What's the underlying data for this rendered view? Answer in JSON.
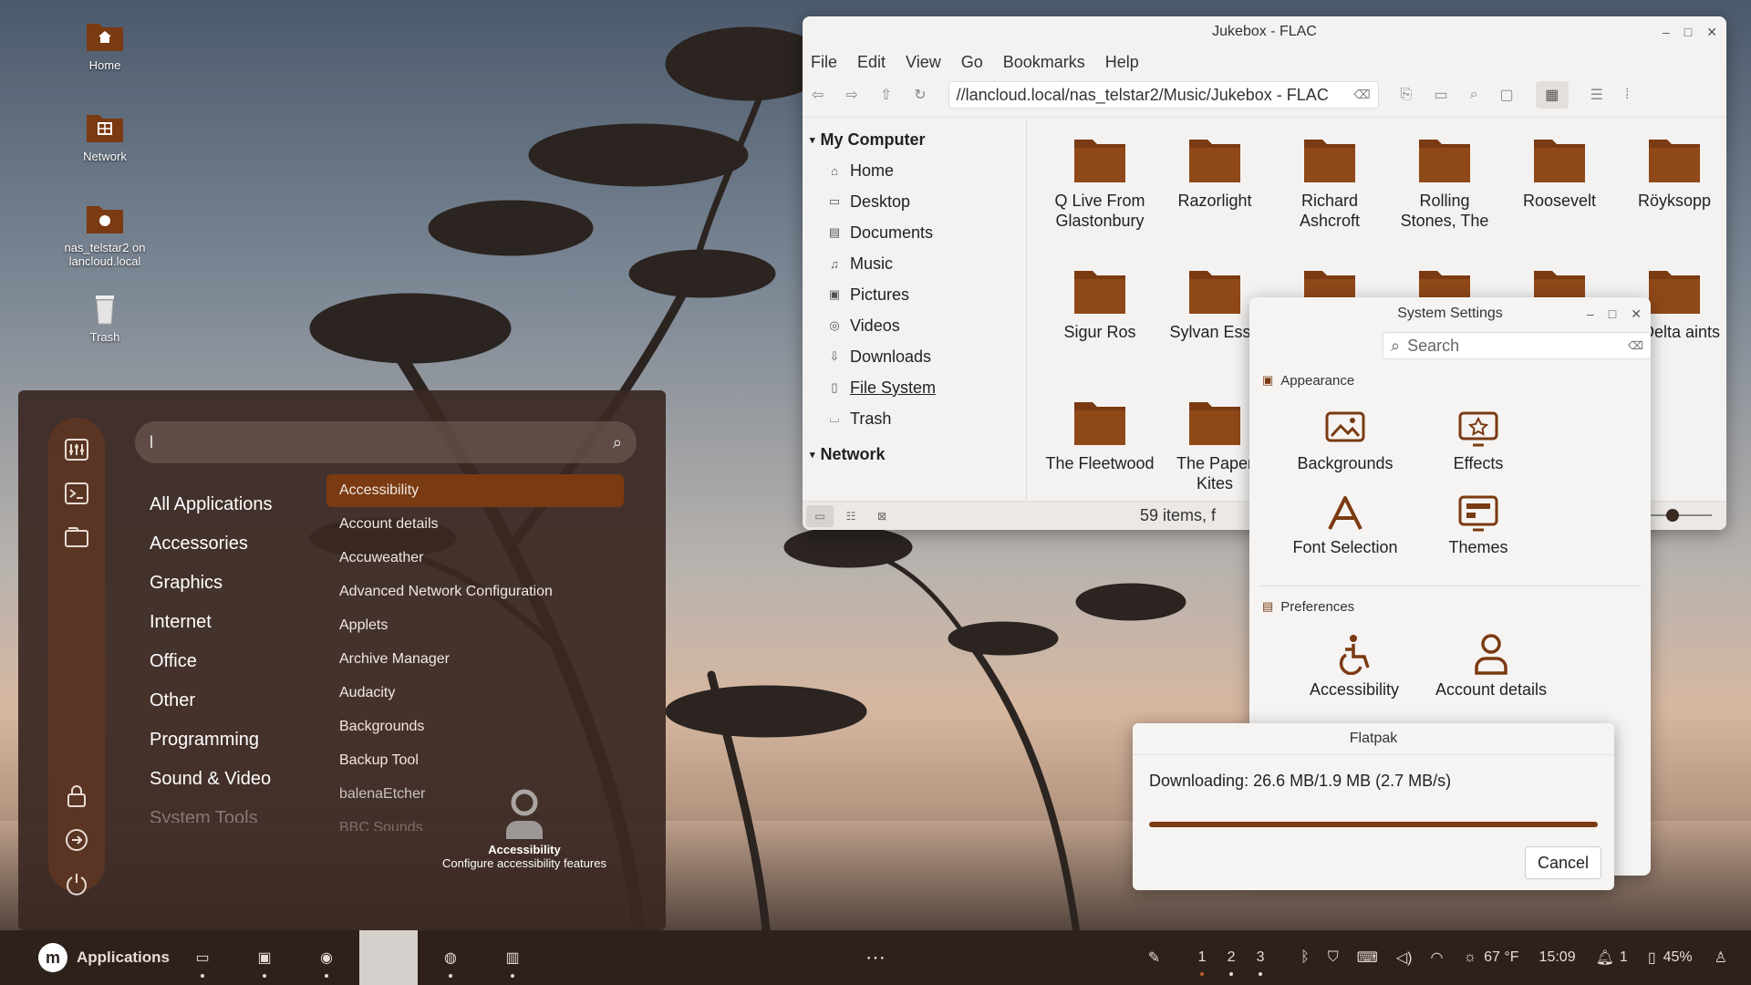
{
  "desktop": {
    "icons": [
      {
        "label": "Home",
        "icon": "home-icon"
      },
      {
        "label": "Network",
        "icon": "network-icon"
      },
      {
        "label": "nas_telstar2 on lancloud.local",
        "icon": "network-share-icon"
      },
      {
        "label": "Trash",
        "icon": "trash-icon"
      }
    ]
  },
  "file_manager": {
    "title": "Jukebox - FLAC",
    "menu": [
      "File",
      "Edit",
      "View",
      "Go",
      "Bookmarks",
      "Help"
    ],
    "path": "//lancloud.local/nas_telstar2/Music/Jukebox - FLAC",
    "sidebar": {
      "my_computer_label": "My Computer",
      "places": [
        {
          "label": "Home",
          "icon": "home-icon"
        },
        {
          "label": "Desktop",
          "icon": "desktop-icon"
        },
        {
          "label": "Documents",
          "icon": "documents-icon"
        },
        {
          "label": "Music",
          "icon": "music-icon"
        },
        {
          "label": "Pictures",
          "icon": "pictures-icon"
        },
        {
          "label": "Videos",
          "icon": "videos-icon"
        },
        {
          "label": "Downloads",
          "icon": "downloads-icon"
        },
        {
          "label": "File System",
          "icon": "drive-icon"
        },
        {
          "label": "Trash",
          "icon": "trash-icon"
        }
      ],
      "network_label": "Network"
    },
    "folders": [
      "Q Live From Glastonbury",
      "Razorlight",
      "Richard Ashcroft",
      "Rolling Stones, The",
      "Roosevelt",
      "Röyksopp",
      "Sigur Ros",
      "Sylvan Esso",
      "",
      "",
      "",
      "e Delta aints",
      "The Fleetwood",
      "The Paper Kites"
    ],
    "status": "59 items, f",
    "colors": {
      "folder": "#7a3a12",
      "accent": "#7a3a12"
    }
  },
  "system_settings": {
    "title": "System Settings",
    "search_placeholder": "Search",
    "appearance_label": "Appearance",
    "appearance_items": [
      {
        "label": "Backgrounds",
        "icon": "backgrounds-icon"
      },
      {
        "label": "Effects",
        "icon": "effects-icon"
      },
      {
        "label": "Font Selection",
        "icon": "font-icon"
      },
      {
        "label": "Themes",
        "icon": "themes-icon"
      }
    ],
    "preferences_label": "Preferences",
    "preferences_items": [
      {
        "label": "Accessibility",
        "icon": "accessibility-icon"
      },
      {
        "label": "Account details",
        "icon": "account-icon"
      }
    ]
  },
  "flatpak": {
    "title": "Flatpak",
    "message": "Downloading: 26.6 MB/1.9 MB (2.7 MB/s)",
    "progress": 1.0,
    "cancel_label": "Cancel"
  },
  "app_menu": {
    "search_value": "l",
    "categories": [
      "All Applications",
      "Accessories",
      "Graphics",
      "Internet",
      "Office",
      "Other",
      "Programming",
      "Sound & Video",
      "System Tools"
    ],
    "apps": [
      "Accessibility",
      "Account details",
      "Accuweather",
      "Advanced Network Configuration",
      "Applets",
      "Archive Manager",
      "Audacity",
      "Backgrounds",
      "Backup Tool",
      "balenaEtcher",
      "BBC Sounds"
    ],
    "selected_app": "Accessibility",
    "preview": {
      "name": "Accessibility",
      "description": "Configure accessibility features"
    }
  },
  "taskbar": {
    "start_label": "Applications",
    "more": "⋯",
    "workspaces": [
      "1",
      "2",
      "3"
    ],
    "weather": "67 °F",
    "time": "15:09",
    "notifications": "1",
    "battery": "45%"
  }
}
